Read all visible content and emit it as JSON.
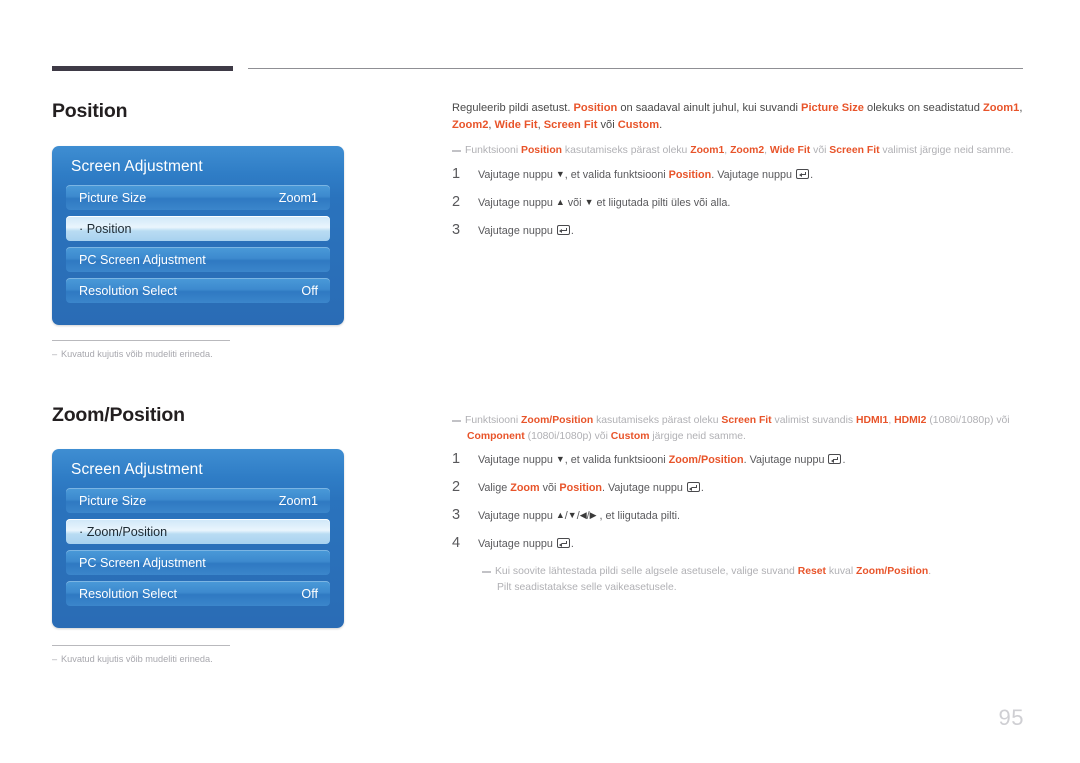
{
  "page": {
    "number": "95"
  },
  "sections": [
    {
      "heading": "Position",
      "osd": {
        "title": "Screen Adjustment",
        "rows": [
          {
            "label": "Picture Size",
            "value": "Zoom1",
            "selected": false
          },
          {
            "label": "· Position",
            "value": "",
            "selected": true
          },
          {
            "label": "PC Screen Adjustment",
            "value": "",
            "selected": false
          },
          {
            "label": "Resolution Select",
            "value": "Off",
            "selected": false
          }
        ]
      },
      "footnote": "Kuvatud kujutis võib mudeliti erineda.",
      "intro_html": "Reguleerib pildi asetust. <b>Position</b> on saadaval ainult juhul, kui suvandi <b>Picture Size</b> olekuks on seadistatud <b>Zoom1</b>, <b>Zoom2</b>, <b>Wide Fit</b>, <b>Screen Fit</b> või <b>Custom</b>.",
      "note_html": "Funktsiooni <b>Position</b> kasutamiseks pärast oleku <b>Zoom1</b>, <b>Zoom2</b>, <b>Wide Fit</b> või <b>Screen Fit</b> valimist järgige neid samme.",
      "steps": [
        {
          "num": "1",
          "html": "Vajutage nuppu <span class=\"arrow\">▼</span>, et valida funktsiooni <b>Position</b>. Vajutage nuppu <span class=\"enter-key\"></span>."
        },
        {
          "num": "2",
          "html": "Vajutage nuppu <span class=\"arrow\">▲</span> või <span class=\"arrow\">▼</span> et liigutada pilti üles või alla."
        },
        {
          "num": "3",
          "html": "Vajutage nuppu <span class=\"enter-key\"></span>."
        }
      ],
      "tail_note_html": ""
    },
    {
      "heading": "Zoom/Position",
      "osd": {
        "title": "Screen Adjustment",
        "rows": [
          {
            "label": "Picture Size",
            "value": "Zoom1",
            "selected": false
          },
          {
            "label": "· Zoom/Position",
            "value": "",
            "selected": true
          },
          {
            "label": "PC Screen Adjustment",
            "value": "",
            "selected": false
          },
          {
            "label": "Resolution Select",
            "value": "Off",
            "selected": false
          }
        ]
      },
      "footnote": "Kuvatud kujutis võib mudeliti erineda.",
      "intro_html": "",
      "note_html": "Funktsiooni <b>Zoom/Position</b> kasutamiseks pärast oleku <b>Screen Fit</b> valimist suvandis <b>HDMI1</b>, <b>HDMI2</b> (1080i/1080p) või <span class=\"indent\"><b>Component</b> (1080i/1080p) või <b>Custom</b> järgige neid samme.</span>",
      "steps": [
        {
          "num": "1",
          "html": "Vajutage nuppu <span class=\"arrow\">▼</span>, et valida funktsiooni <b>Zoom/Position</b>. Vajutage nuppu <span class=\"enter-key\"></span>."
        },
        {
          "num": "2",
          "html": "Valige <b>Zoom</b> või <b>Position</b>. Vajutage nuppu <span class=\"enter-key\"></span>."
        },
        {
          "num": "3",
          "html": "Vajutage nuppu <span class=\"arrow\">▲</span>/<span class=\"arrow\">▼</span>/<span class=\"arrow\">◀</span>/<span class=\"arrow\">▶</span> , et liigutada pilti."
        },
        {
          "num": "4",
          "html": "Vajutage nuppu <span class=\"enter-key\"></span>."
        }
      ],
      "tail_note_html": "Kui soovite lähtestada pildi selle algsele asetusele, valige suvand <b>Reset</b> kuval <b>Zoom/Position</b>. <span class=\"indent\">Pilt seadistatakse selle vaikeasetusele.</span>"
    }
  ]
}
